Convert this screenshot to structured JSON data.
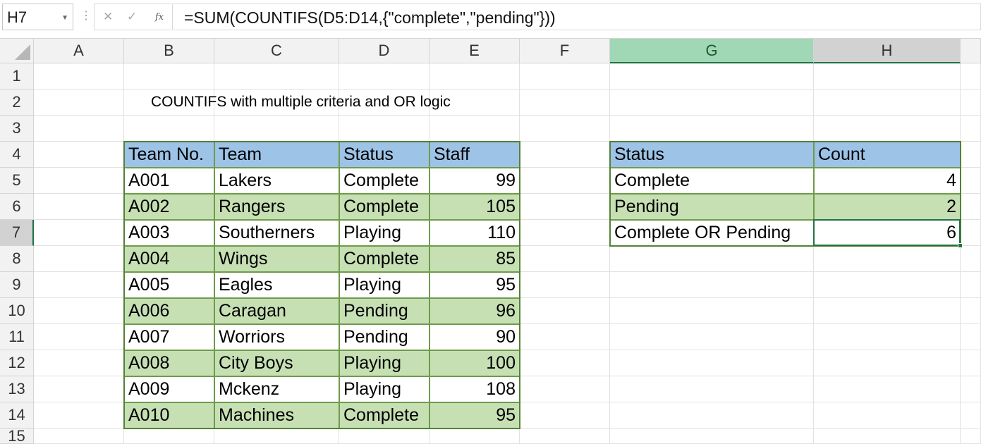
{
  "formula_bar": {
    "name_box": "H7",
    "cancel_icon": "✕",
    "enter_icon": "✓",
    "fx_label": "fx",
    "formula": "=SUM(COUNTIFS(D5:D14,{\"complete\",\"pending\"}))"
  },
  "columns": [
    "A",
    "B",
    "C",
    "D",
    "E",
    "F",
    "G",
    "H"
  ],
  "rows": [
    "1",
    "2",
    "3",
    "4",
    "5",
    "6",
    "7",
    "8",
    "9",
    "10",
    "11",
    "12",
    "13",
    "14",
    "15"
  ],
  "active_cell": "H7",
  "sheet_title": "COUNTIFS with multiple criteria and OR logic",
  "teams_table": {
    "headers": [
      "Team No.",
      "Team",
      "Status",
      "Staff"
    ],
    "rows": [
      [
        "A001",
        "Lakers",
        "Complete",
        "99"
      ],
      [
        "A002",
        "Rangers",
        "Complete",
        "105"
      ],
      [
        "A003",
        "Southerners",
        "Playing",
        "110"
      ],
      [
        "A004",
        "Wings",
        "Complete",
        "85"
      ],
      [
        "A005",
        "Eagles",
        "Playing",
        "95"
      ],
      [
        "A006",
        "Caragan",
        "Pending",
        "96"
      ],
      [
        "A007",
        "Worriors",
        "Pending",
        "90"
      ],
      [
        "A008",
        "City Boys",
        "Playing",
        "100"
      ],
      [
        "A009",
        "Mckenz",
        "Playing",
        "108"
      ],
      [
        "A010",
        "Machines",
        "Complete",
        "95"
      ]
    ]
  },
  "summary_table": {
    "headers": [
      "Status",
      "Count"
    ],
    "rows": [
      [
        "Complete",
        "4"
      ],
      [
        "Pending",
        "2"
      ],
      [
        "Complete OR Pending",
        "6"
      ]
    ]
  },
  "colors": {
    "header_fill": "#9dc3e6",
    "band_fill": "#c6e0b4",
    "table_border": "#538135",
    "selection": "#217346"
  }
}
